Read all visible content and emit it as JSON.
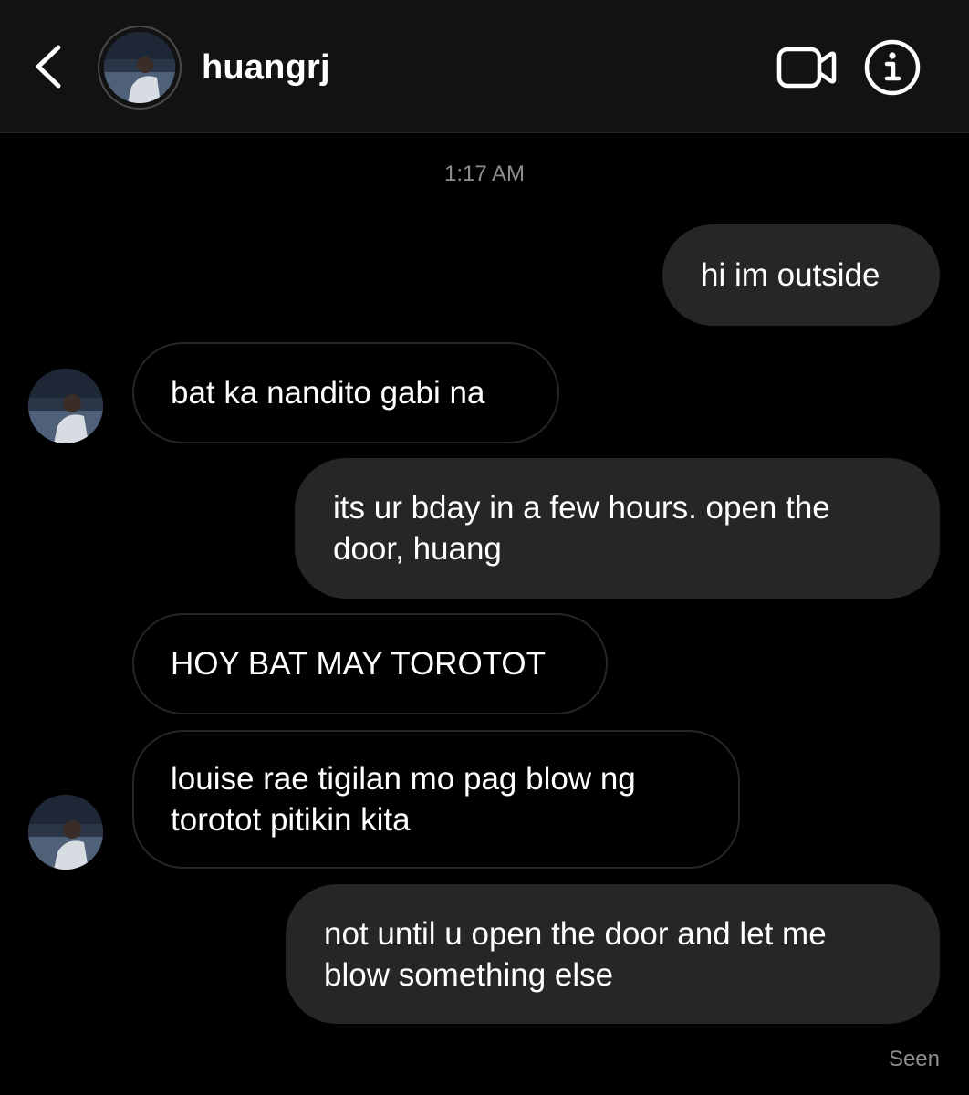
{
  "header": {
    "back_icon": "chevron-left-icon",
    "username": "huangrj",
    "video_icon": "video-camera-icon",
    "info_icon": "info-icon"
  },
  "thread": {
    "timestamp": "1:17 AM",
    "messages": [
      {
        "direction": "sent",
        "text": "hi im outside"
      },
      {
        "direction": "received",
        "text": "bat ka nandito gabi na"
      },
      {
        "direction": "sent",
        "text": "its ur bday in a few hours. open the\ndoor, huang"
      },
      {
        "direction": "received",
        "text": "HOY BAT MAY TOROTOT"
      },
      {
        "direction": "received",
        "text": "louise rae tigilan mo pag blow ng\ntorotot pitikin kita"
      },
      {
        "direction": "sent",
        "text": "not until u open the door and let me\nblow something else"
      }
    ],
    "status": "Seen"
  },
  "colors": {
    "background": "#000000",
    "header": "#121212",
    "sent_bubble": "#262626",
    "received_border": "#262626",
    "muted_text": "#8e8e8e"
  }
}
